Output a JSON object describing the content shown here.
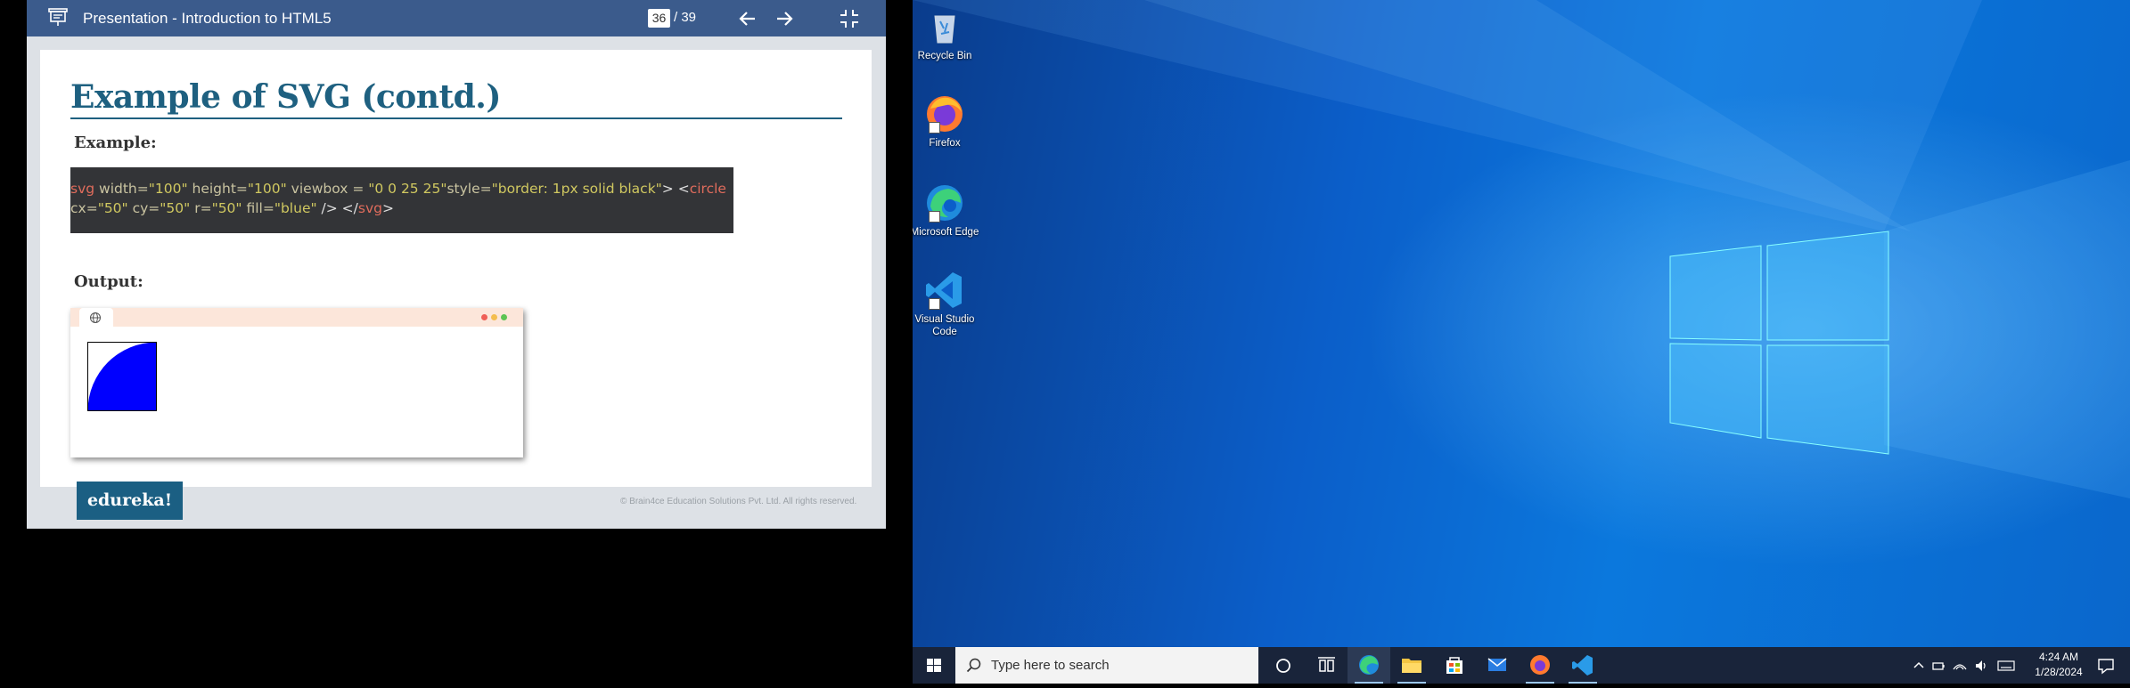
{
  "viewer": {
    "title": "Presentation - Introduction to HTML5",
    "page_current": "36",
    "page_total": "/ 39"
  },
  "slide": {
    "title": "Example of SVG (contd.)",
    "example_label": "Example:",
    "code": {
      "line1_tag": "svg",
      "line1_attr1": " width=",
      "line1_val1": "\"100\"",
      "line1_attr2": " height=",
      "line1_val2": "\"100\"",
      "line1_attr3": " viewbox = ",
      "line1_val3": "\"0 0 25 25\"",
      "line1_attr4": "style=",
      "line1_val4": "\"border: 1px solid black\"",
      "line1_close": "> <",
      "line1_tag2": "circle",
      "line2_attr1": "cx=",
      "line2_val1": "\"50\"",
      "line2_attr2": " cy=",
      "line2_val2": "\"50\"",
      "line2_attr3": " r=",
      "line2_val3": "\"50\"",
      "line2_attr4": " fill=",
      "line2_val4": "\"blue\"",
      "line2_close": " /> </",
      "line2_tag": "svg",
      "line2_end": ">"
    },
    "output_label": "Output:",
    "logo": "edureka!",
    "copyright": "© Brain4ce Education Solutions Pvt. Ltd. All rights reserved."
  },
  "desktop": {
    "icons": [
      {
        "label": "Recycle Bin"
      },
      {
        "label": "Firefox"
      },
      {
        "label": "Microsoft Edge"
      },
      {
        "label": "Visual Studio Code"
      }
    ]
  },
  "taskbar": {
    "search_placeholder": "Type here to search",
    "time": "4:24 AM",
    "date": "1/28/2024"
  },
  "colors": {
    "viewer_bar": "#3b5b8c",
    "slide_title": "#1e6080",
    "logo_bg": "#1b5f83",
    "desktop_blue": "#0b78dd",
    "taskbar": "#19243a"
  }
}
